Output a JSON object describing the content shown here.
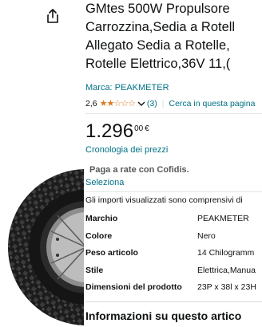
{
  "icons": {
    "share": "share-icon",
    "rating_chevron": "chevron-down-icon"
  },
  "colors": {
    "link": "#007185",
    "star": "#de7921",
    "text": "#0f1111"
  },
  "product": {
    "title_lines": [
      "GMtes 500W Propulsore",
      "Carrozzina,Sedia a Rotell",
      "Allegato Sedia a Rotelle,",
      "Rotelle Elettrico,36V 11,("
    ],
    "brand": "Marca: PEAKMETER",
    "rating": {
      "value": "2,6",
      "stars": "★★☆☆☆",
      "count": "(3)",
      "search": "Cerca in questa pagina"
    }
  },
  "price": {
    "whole": "1.296",
    "fraction": "00",
    "currency": "€",
    "history_link": "Cronologia dei prezzi",
    "installment": "Paga a rate con Cofidis.",
    "select_link": "Seleziona"
  },
  "note": "Gli importi visualizzati sono comprensivi di",
  "specs": [
    {
      "key": "Marchio",
      "value": "PEAKMETER"
    },
    {
      "key": "Colore",
      "value": "Nero"
    },
    {
      "key": "Peso articolo",
      "value": "14 Chilogramm"
    },
    {
      "key": "Stile",
      "value": "Elettrica,Manua"
    },
    {
      "key": "Dimensioni del prodotto",
      "value": "23P x 38l x 23H"
    }
  ],
  "info_heading": "Informazioni su questo artico"
}
